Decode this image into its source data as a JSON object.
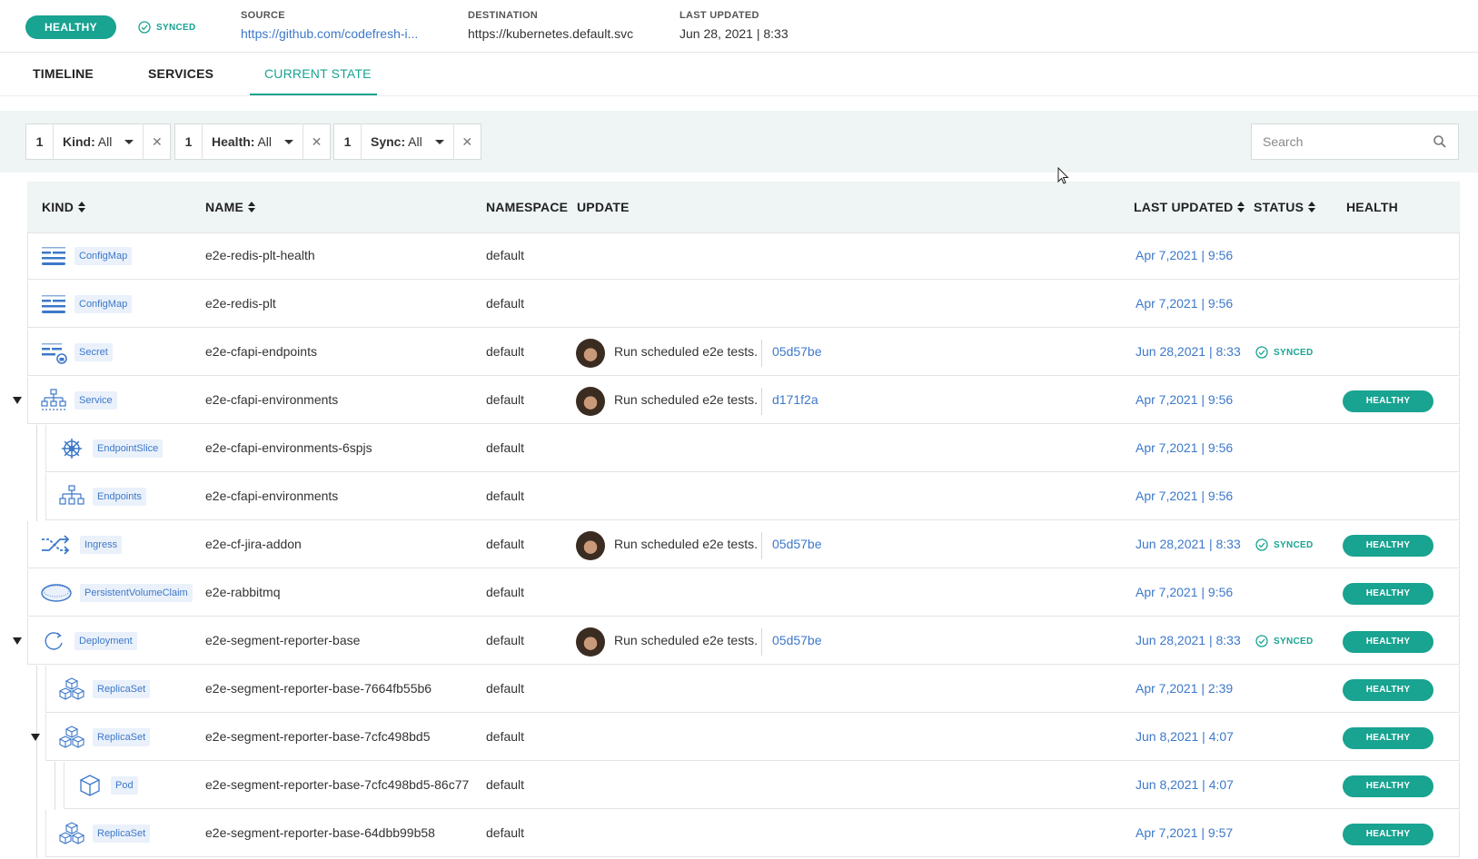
{
  "header": {
    "health": "HEALTHY",
    "sync": "SYNCED",
    "source_label": "SOURCE",
    "source_value": "https://github.com/codefresh-i...",
    "destination_label": "DESTINATION",
    "destination_value": "https://kubernetes.default.svc",
    "last_updated_label": "LAST UPDATED",
    "last_updated_value": "Jun 28, 2021 | 8:33"
  },
  "tabs": [
    {
      "label": "TIMELINE"
    },
    {
      "label": "SERVICES"
    },
    {
      "label": "CURRENT STATE",
      "active": true
    }
  ],
  "filters": [
    {
      "count": "1",
      "name": "Kind:",
      "value": "All"
    },
    {
      "count": "1",
      "name": "Health:",
      "value": "All"
    },
    {
      "count": "1",
      "name": "Sync:",
      "value": "All"
    }
  ],
  "search": {
    "placeholder": "Search"
  },
  "columns": {
    "kind": "KIND",
    "name": "NAME",
    "namespace": "NAMESPACE",
    "update": "UPDATE",
    "last_updated": "LAST UPDATED",
    "status": "STATUS",
    "health": "HEALTH"
  },
  "colors": {
    "accent": "#19a391",
    "link": "#3d78c9",
    "badge_bg": "#eaf1fb"
  },
  "rows": [
    {
      "kind": "ConfigMap",
      "icon": "configmap-icon",
      "name": "e2e-redis-plt-health",
      "namespace": "default",
      "last_updated": "Apr 7,2021 | 9:56",
      "depth": 0
    },
    {
      "kind": "ConfigMap",
      "icon": "configmap-icon",
      "name": "e2e-redis-plt",
      "namespace": "default",
      "last_updated": "Apr 7,2021 | 9:56",
      "depth": 0
    },
    {
      "kind": "Secret",
      "icon": "secret-icon",
      "name": "e2e-cfapi-endpoints",
      "namespace": "default",
      "commit_msg": "Run scheduled e2e tests.",
      "commit_sha": "05d57be",
      "last_updated": "Jun 28,2021 | 8:33",
      "status": "SYNCED",
      "depth": 0
    },
    {
      "kind": "Service",
      "icon": "service-icon",
      "name": "e2e-cfapi-environments",
      "namespace": "default",
      "commit_msg": "Run scheduled e2e tests.",
      "commit_sha": "d171f2a",
      "last_updated": "Apr 7,2021 | 9:56",
      "health": "HEALTHY",
      "depth": 0,
      "expanded": true
    },
    {
      "kind": "EndpointSlice",
      "icon": "endpointslice-icon",
      "name": "e2e-cfapi-environments-6spjs",
      "namespace": "default",
      "last_updated": "Apr 7,2021 | 9:56",
      "depth": 1
    },
    {
      "kind": "Endpoints",
      "icon": "endpoints-icon",
      "name": "e2e-cfapi-environments",
      "namespace": "default",
      "last_updated": "Apr 7,2021 | 9:56",
      "depth": 1
    },
    {
      "kind": "Ingress",
      "icon": "ingress-icon",
      "name": "e2e-cf-jira-addon",
      "namespace": "default",
      "commit_msg": "Run scheduled e2e tests.",
      "commit_sha": "05d57be",
      "last_updated": "Jun 28,2021 | 8:33",
      "status": "SYNCED",
      "health": "HEALTHY",
      "depth": 0
    },
    {
      "kind": "PersistentVolumeClaim",
      "icon": "pvc-icon",
      "name": "e2e-rabbitmq",
      "namespace": "default",
      "last_updated": "Apr 7,2021 | 9:56",
      "health": "HEALTHY",
      "depth": 0
    },
    {
      "kind": "Deployment",
      "icon": "deployment-icon",
      "name": "e2e-segment-reporter-base",
      "namespace": "default",
      "commit_msg": "Run scheduled e2e tests.",
      "commit_sha": "05d57be",
      "last_updated": "Jun 28,2021 | 8:33",
      "status": "SYNCED",
      "health": "HEALTHY",
      "depth": 0,
      "expanded": true
    },
    {
      "kind": "ReplicaSet",
      "icon": "replicaset-icon",
      "name": "e2e-segment-reporter-base-7664fb55b6",
      "namespace": "default",
      "last_updated": "Apr 7,2021 | 2:39",
      "health": "HEALTHY",
      "depth": 1
    },
    {
      "kind": "ReplicaSet",
      "icon": "replicaset-icon",
      "name": "e2e-segment-reporter-base-7cfc498bd5",
      "namespace": "default",
      "last_updated": "Jun 8,2021 | 4:07",
      "health": "HEALTHY",
      "depth": 1,
      "expanded": true
    },
    {
      "kind": "Pod",
      "icon": "pod-icon",
      "name": "e2e-segment-reporter-base-7cfc498bd5-86c77",
      "namespace": "default",
      "last_updated": "Jun 8,2021 | 4:07",
      "health": "HEALTHY",
      "depth": 2
    },
    {
      "kind": "ReplicaSet",
      "icon": "replicaset-icon",
      "name": "e2e-segment-reporter-base-64dbb99b58",
      "namespace": "default",
      "last_updated": "Apr 7,2021 | 9:57",
      "health": "HEALTHY",
      "depth": 1
    }
  ]
}
